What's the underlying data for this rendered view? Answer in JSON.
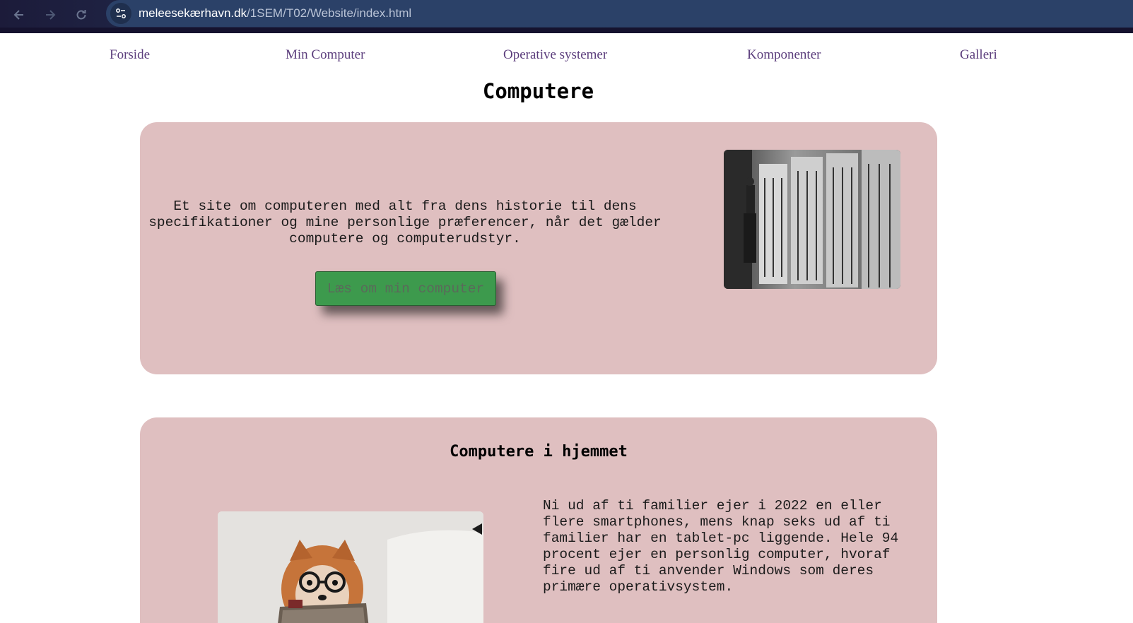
{
  "browser": {
    "url_host": "meleesekærhavn.dk",
    "url_path": "/1SEM/T02/Website/index.html",
    "icons": [
      "back-arrow-icon",
      "forward-arrow-icon",
      "reload-icon",
      "site-settings-icon"
    ]
  },
  "nav": {
    "items": [
      "Forside",
      "Min Computer",
      "Operative systemer",
      "Komponenter",
      "Galleri"
    ],
    "link_color": "#5b3d7c"
  },
  "page": {
    "title": "Computere"
  },
  "intro": {
    "text": "Et site om computeren med alt fra dens historie til dens specifikationer og mine personlige præferencer, når det gælder computere og computerudstyr.",
    "button_label": "Læs om min computer",
    "button_color": "#3d9a4d",
    "card_color": "#dfbfc0"
  },
  "home_section": {
    "heading": "Computere i hjemmet",
    "text": "Ni ud af ti familier ejer i 2022 en eller flere smartphones, mens knap seks ud af ti familier har en tablet-pc liggende. Hele 94 procent ejer en personlig computer, hvoraf fire ud af ti anvender Windows som deres primære operativsystem."
  }
}
